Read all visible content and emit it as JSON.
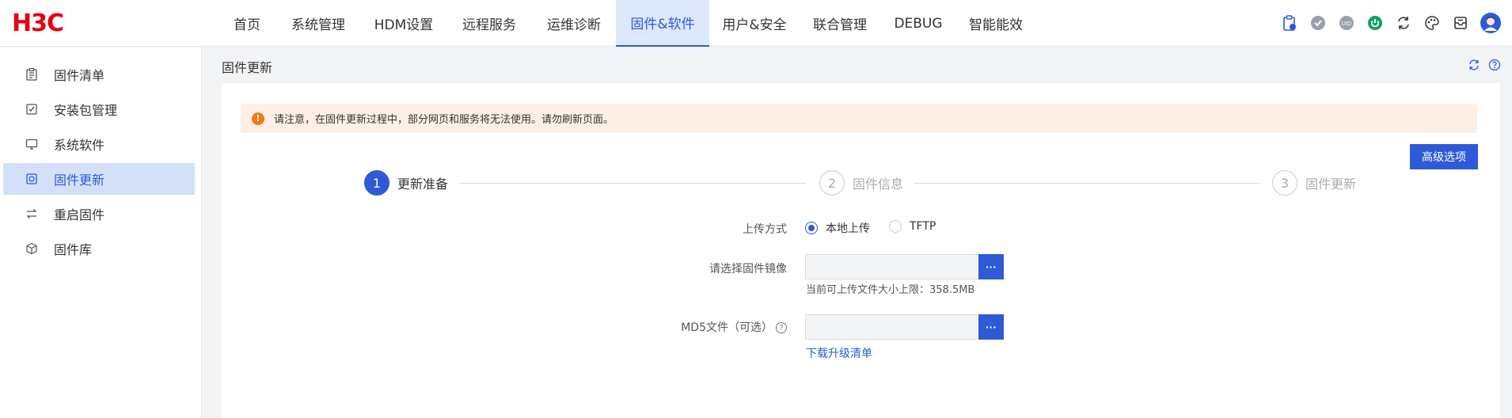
{
  "brand": {
    "logo": "H3C"
  },
  "nav": [
    "首页",
    "系统管理",
    "HDM设置",
    "远程服务",
    "运维诊断",
    "固件&软件",
    "用户&安全",
    "联合管理",
    "DEBUG",
    "智能能效"
  ],
  "nav_active_index": 5,
  "top_icons": [
    "clipboard-icon",
    "shield-icon",
    "uid-icon",
    "power-icon",
    "refresh-arrows-icon",
    "palette-icon",
    "mailbox-icon",
    "user-avatar-icon"
  ],
  "top_icon_uid_text": "UID",
  "sidebar": [
    {
      "label": "固件清单",
      "icon": "list-icon"
    },
    {
      "label": "安装包管理",
      "icon": "package-icon"
    },
    {
      "label": "系统软件",
      "icon": "monitor-icon"
    },
    {
      "label": "固件更新",
      "icon": "firmware-icon"
    },
    {
      "label": "重启固件",
      "icon": "restart-icon"
    },
    {
      "label": "固件库",
      "icon": "cube-icon"
    }
  ],
  "sidebar_active_index": 3,
  "page": {
    "title": "固件更新",
    "notice": "请注意，在固件更新过程中，部分网页和服务将无法使用。请勿刷新页面。",
    "advanced_button": "高级选项",
    "steps": [
      {
        "num": "1",
        "label": "更新准备"
      },
      {
        "num": "2",
        "label": "固件信息"
      },
      {
        "num": "3",
        "label": "固件更新"
      }
    ],
    "form": {
      "upload_label": "上传方式",
      "radio_local": "本地上传",
      "radio_tftp": "TFTP",
      "image_label": "请选择固件镜像",
      "image_value": "",
      "browse": "···",
      "size_hint": "当前可上传文件大小上限：358.5MB",
      "md5_label": "MD5文件（可选）",
      "md5_help": "?",
      "md5_value": "",
      "download_link": "下载升级清单"
    }
  },
  "colors": {
    "accent": "#2e5ad8",
    "logo": "#e60012",
    "warning": "#f07a1a",
    "notice_bg": "#fdefe6"
  }
}
